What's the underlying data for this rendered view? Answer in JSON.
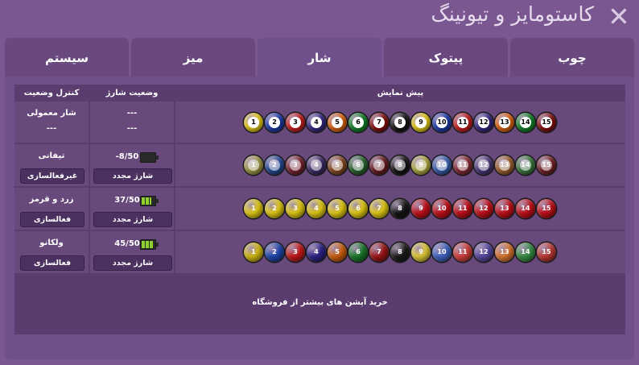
{
  "window": {
    "title": "کاستومایز و تیونینگ",
    "close_glyph": "✕"
  },
  "tabs": [
    {
      "label": "چوب",
      "active": false
    },
    {
      "label": "پیتوک",
      "active": false
    },
    {
      "label": "شار",
      "active": true
    },
    {
      "label": "میز",
      "active": false
    },
    {
      "label": "سیستم",
      "active": false
    }
  ],
  "table": {
    "headers": {
      "status_control": "کنترل وضعیت",
      "charge_status": "وضعیت شارژ",
      "preview": "پیش نمایش"
    },
    "rows": [
      {
        "name": "شار معمولی",
        "action": "---",
        "charge": "---",
        "recharge": "---",
        "battery_level": null,
        "balls": [
          "1",
          "2",
          "3",
          "4",
          "5",
          "6",
          "7",
          "8",
          "9",
          "10",
          "11",
          "12",
          "13",
          "14",
          "15"
        ],
        "style": "classic"
      },
      {
        "name": "تیفانی",
        "action": "غیرفعالسازی",
        "charge": "-8/50",
        "recharge": "شارژ مجدد",
        "battery_level": 0,
        "balls": [
          "1",
          "2",
          "3",
          "4",
          "5",
          "6",
          "7",
          "8",
          "9",
          "10",
          "11",
          "12",
          "13",
          "14",
          "15"
        ],
        "style": "tiffany"
      },
      {
        "name": "زرد و قرمز",
        "action": "فعالسازی",
        "charge": "37/50",
        "recharge": "شارژ مجدد",
        "battery_level": 0.74,
        "balls": [
          "1",
          "2",
          "3",
          "4",
          "5",
          "6",
          "7",
          "8",
          "9",
          "10",
          "11",
          "12",
          "13",
          "14",
          "15"
        ],
        "style": "yellow_red"
      },
      {
        "name": "ولکانو",
        "action": "فعالسازی",
        "charge": "45/50",
        "recharge": "شارژ مجدد",
        "battery_level": 0.9,
        "balls": [
          "1",
          "2",
          "3",
          "4",
          "5",
          "6",
          "7",
          "8",
          "9",
          "10",
          "11",
          "12",
          "13",
          "14",
          "15"
        ],
        "style": "volcano"
      }
    ]
  },
  "shop_link": "خرید آپشن های بیشتر از فروشگاه",
  "colors": {
    "background": "#7a5790",
    "panel": "#70508a",
    "inner": "#5b3c6f",
    "row": "#68497b",
    "button": "#4b3160",
    "battery_fill": "#8fd12f"
  }
}
